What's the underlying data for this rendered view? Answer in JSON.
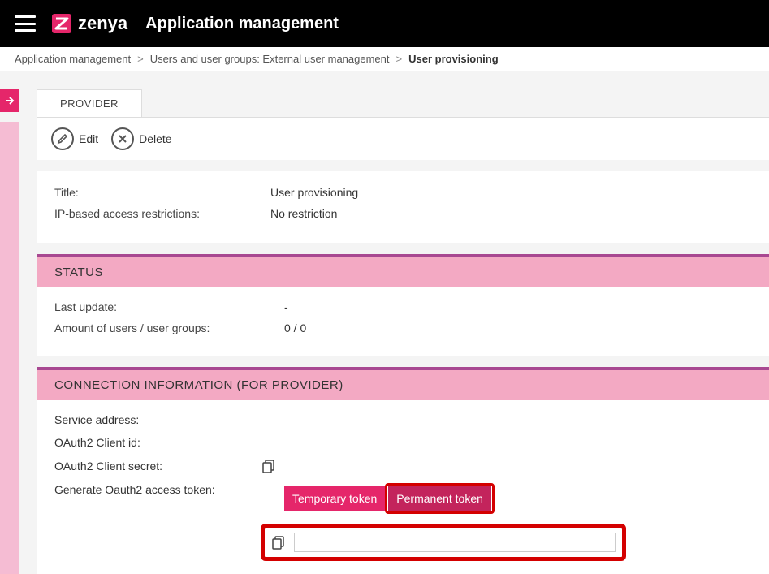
{
  "header": {
    "brand": "zenya",
    "app_title": "Application management"
  },
  "breadcrumb": {
    "items": [
      "Application management",
      "Users and user groups: External user management"
    ],
    "current": "User provisioning"
  },
  "tabs": {
    "provider": "PROVIDER"
  },
  "toolbar": {
    "edit_label": "Edit",
    "delete_label": "Delete"
  },
  "details": {
    "title_label": "Title:",
    "title_value": "User provisioning",
    "ip_label": "IP-based access restrictions:",
    "ip_value": "No restriction"
  },
  "status": {
    "header": "STATUS",
    "last_update_label": "Last update:",
    "last_update_value": "-",
    "count_label": "Amount of users / user groups:",
    "count_value": "0 / 0"
  },
  "connection": {
    "header": "CONNECTION INFORMATION (FOR PROVIDER)",
    "service_address_label": "Service address:",
    "service_address_value": "",
    "client_id_label": "OAuth2 Client id:",
    "client_id_value": "",
    "client_secret_label": "OAuth2 Client secret:",
    "generate_label": "Generate Oauth2 access token:",
    "temp_token_label": "Temporary token",
    "perm_token_label": "Permanent token",
    "token_value": ""
  }
}
